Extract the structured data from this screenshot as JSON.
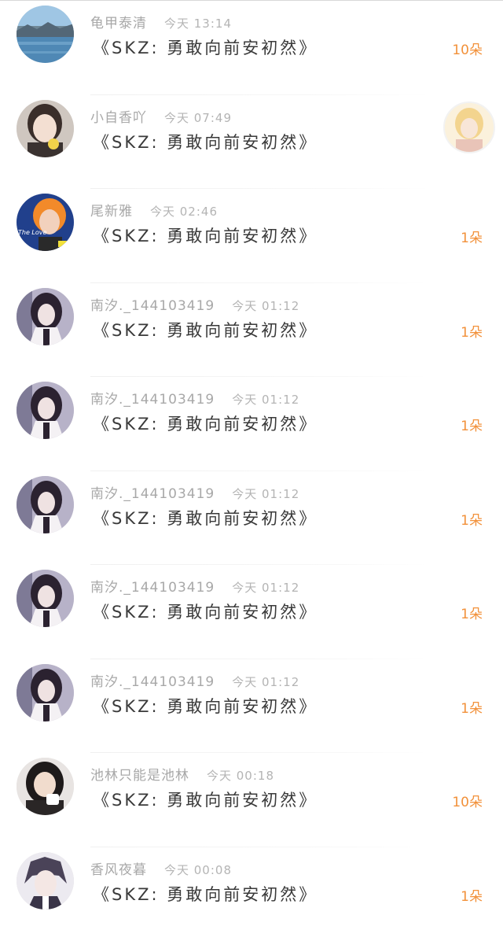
{
  "comments": [
    {
      "user": "龟甲泰清",
      "time": "今天 13:14",
      "message": "《SKZ: 勇敢向前安初然》",
      "reward": "10朵",
      "avatar": "landscape-avatar"
    },
    {
      "user": "小自香吖",
      "time": "今天 07:49",
      "message": "《SKZ: 勇敢向前安初然》",
      "reward": "",
      "avatar": "girl-avatar",
      "thumb": "blonde-portrait-thumbnail"
    },
    {
      "user": "尾新雅",
      "time": "今天 02:46",
      "message": "《SKZ: 勇敢向前安初然》",
      "reward": "1朵",
      "avatar": "orange-hair-avatar",
      "avatar_text": "The Love"
    },
    {
      "user": "南汐._144103419",
      "time": "今天 01:12",
      "message": "《SKZ: 勇敢向前安初然》",
      "reward": "1朵",
      "avatar": "dark-hair-girl-avatar"
    },
    {
      "user": "南汐._144103419",
      "time": "今天 01:12",
      "message": "《SKZ: 勇敢向前安初然》",
      "reward": "1朵",
      "avatar": "dark-hair-girl-avatar"
    },
    {
      "user": "南汐._144103419",
      "time": "今天 01:12",
      "message": "《SKZ: 勇敢向前安初然》",
      "reward": "1朵",
      "avatar": "dark-hair-girl-avatar"
    },
    {
      "user": "南汐._144103419",
      "time": "今天 01:12",
      "message": "《SKZ: 勇敢向前安初然》",
      "reward": "1朵",
      "avatar": "dark-hair-girl-avatar"
    },
    {
      "user": "南汐._144103419",
      "time": "今天 01:12",
      "message": "《SKZ: 勇敢向前安初然》",
      "reward": "1朵",
      "avatar": "dark-hair-girl-avatar"
    },
    {
      "user": "池林只能是池林",
      "time": "今天 00:18",
      "message": "《SKZ: 勇敢向前安初然》",
      "reward": "10朵",
      "avatar": "girl-eating-avatar"
    },
    {
      "user": "香风夜暮",
      "time": "今天 00:08",
      "message": "《SKZ: 勇敢向前安初然》",
      "reward": "1朵",
      "avatar": "anime-avatar"
    }
  ],
  "colors": {
    "username": "#a8a8a8",
    "timestamp": "#b4b4b4",
    "message": "#3a3a3a",
    "reward": "#f2913a",
    "divider": "#f0f0f0"
  }
}
